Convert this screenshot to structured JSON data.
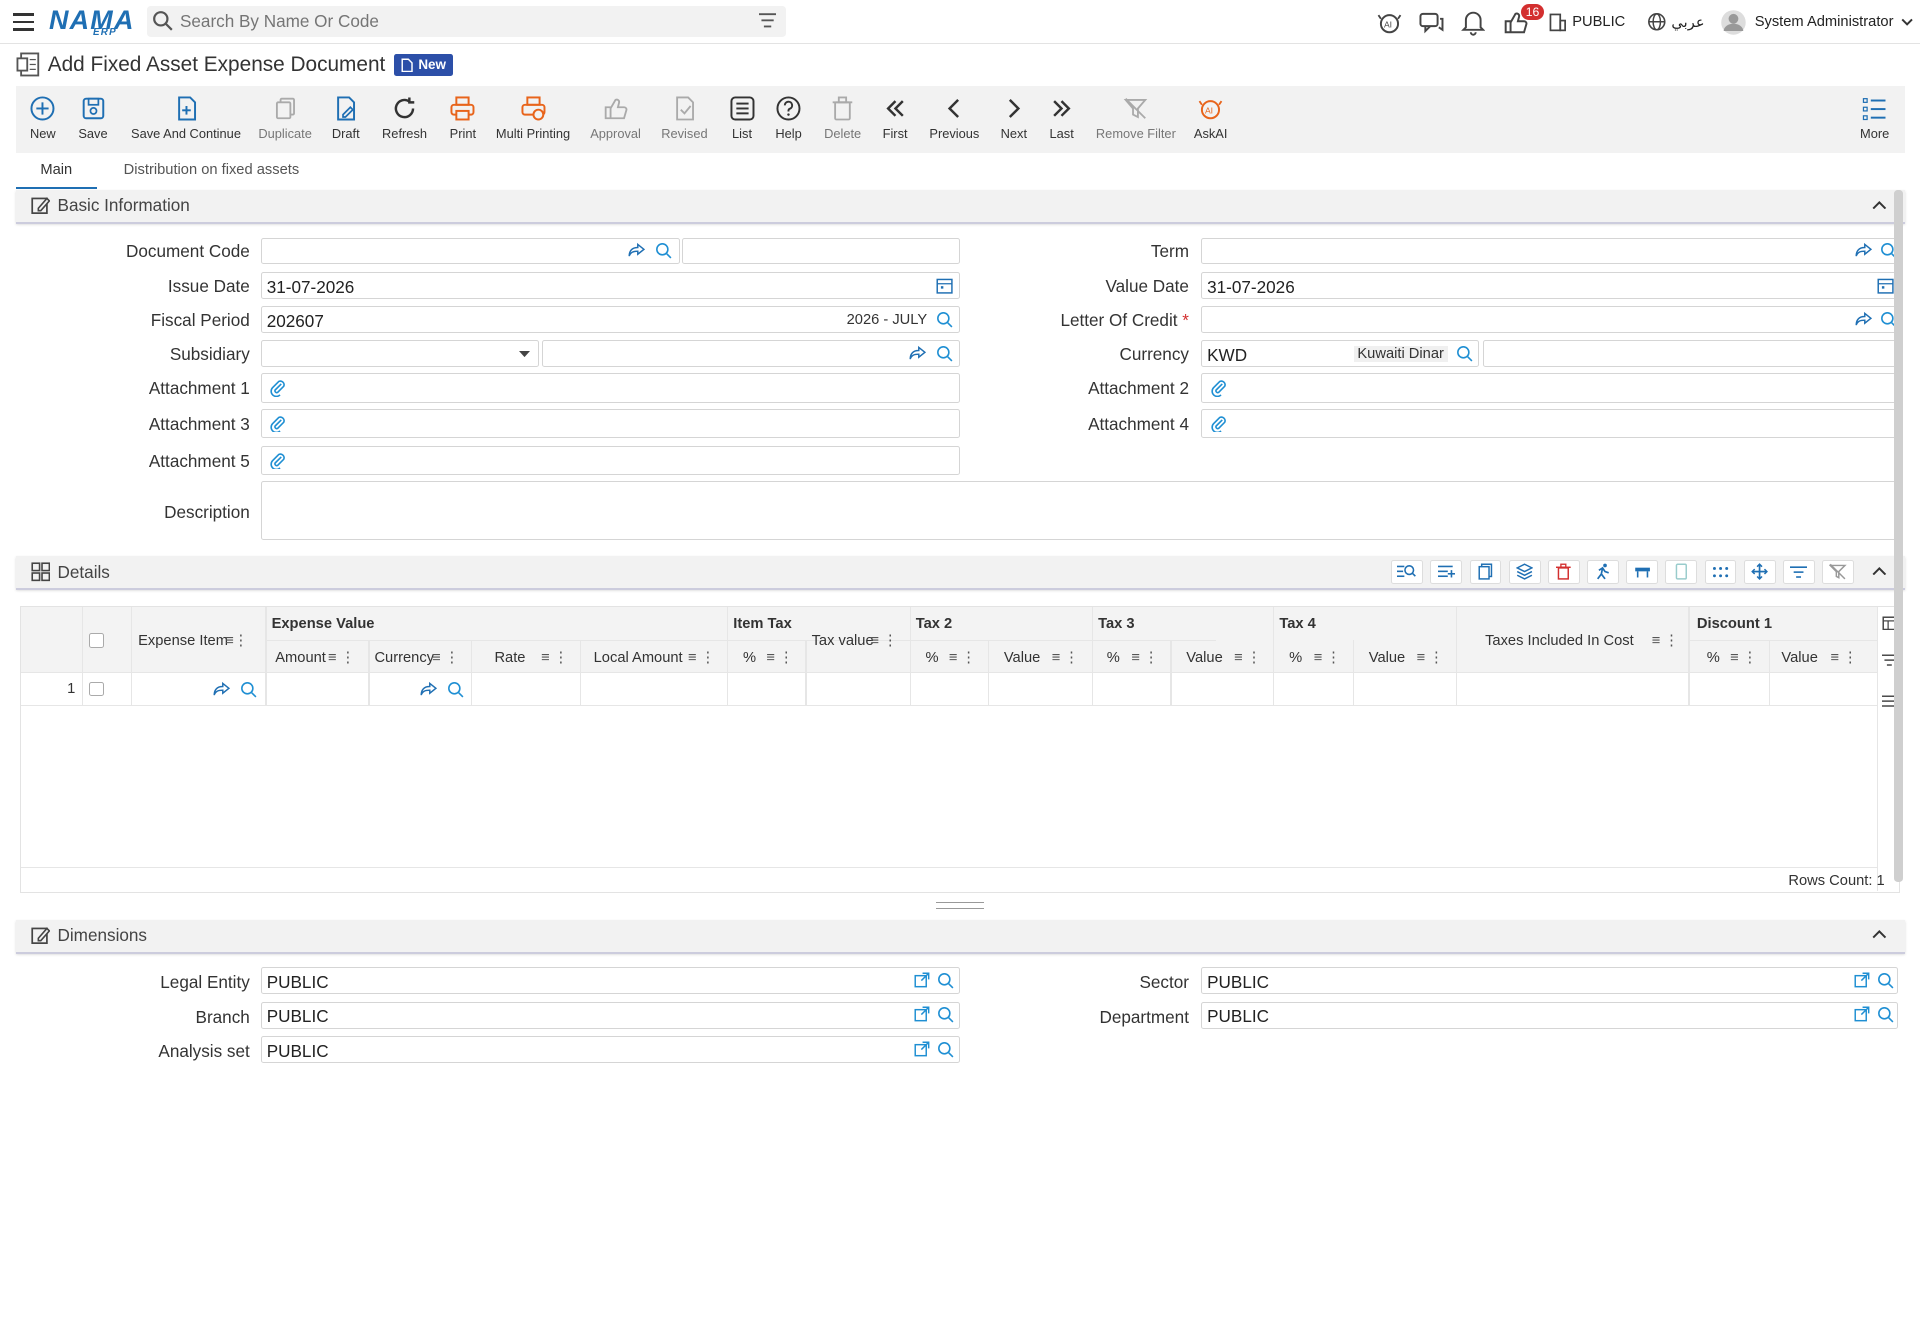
{
  "app": {
    "logo": "NAMA",
    "logo_sub": "ERP"
  },
  "search": {
    "placeholder": "Search By Name Or Code"
  },
  "topbar": {
    "notif_count": "16",
    "company": "PUBLIC",
    "language": "عربي",
    "user": "System Administrator"
  },
  "page": {
    "title": "Add Fixed Asset Expense Document",
    "badge": "New"
  },
  "toolbar": [
    {
      "label": "New"
    },
    {
      "label": "Save"
    },
    {
      "label": "Save And Continue"
    },
    {
      "label": "Duplicate"
    },
    {
      "label": "Draft"
    },
    {
      "label": "Refresh"
    },
    {
      "label": "Print"
    },
    {
      "label": "Multi Printing"
    },
    {
      "label": "Approval"
    },
    {
      "label": "Revised"
    },
    {
      "label": "List"
    },
    {
      "label": "Help"
    },
    {
      "label": "Delete"
    },
    {
      "label": "First"
    },
    {
      "label": "Previous"
    },
    {
      "label": "Next"
    },
    {
      "label": "Last"
    },
    {
      "label": "Remove Filter"
    },
    {
      "label": "AskAI"
    },
    {
      "label": "More"
    }
  ],
  "tabs": [
    "Main",
    "Distribution on fixed assets"
  ],
  "basic": {
    "title": "Basic Information",
    "document_code": {
      "label": "Document Code",
      "value": ""
    },
    "issue_date": {
      "label": "Issue Date",
      "value": "31-07-2026"
    },
    "fiscal_period": {
      "label": "Fiscal Period",
      "value": "202607",
      "desc": "2026 - JULY"
    },
    "subsidiary": {
      "label": "Subsidiary",
      "value": ""
    },
    "attachment1": {
      "label": "Attachment 1"
    },
    "attachment3": {
      "label": "Attachment 3"
    },
    "attachment5": {
      "label": "Attachment 5"
    },
    "description": {
      "label": "Description",
      "value": ""
    },
    "term": {
      "label": "Term",
      "value": ""
    },
    "value_date": {
      "label": "Value Date",
      "value": "31-07-2026"
    },
    "letter_of_credit": {
      "label": "Letter Of Credit",
      "required": "*"
    },
    "currency": {
      "label": "Currency",
      "value": "KWD",
      "desc": "Kuwaiti Dinar"
    },
    "attachment2": {
      "label": "Attachment 2"
    },
    "attachment4": {
      "label": "Attachment 4"
    }
  },
  "details": {
    "title": "Details",
    "headers": {
      "expense_item": "Expense Item",
      "expense_value": "Expense Value",
      "amount": "Amount",
      "currency": "Currency",
      "rate": "Rate",
      "local_amount": "Local Amount",
      "item_tax": "Item Tax",
      "pct": "%",
      "tax_value": "Tax value",
      "tax2": "Tax 2",
      "tax3": "Tax 3",
      "tax4": "Tax 4",
      "value": "Value",
      "taxes_included": "Taxes Included In Cost",
      "discount1": "Discount 1"
    },
    "rows": [
      {
        "num": "1"
      }
    ],
    "rows_count": "Rows Count: 1"
  },
  "dimensions": {
    "title": "Dimensions",
    "legal_entity": {
      "label": "Legal Entity",
      "value": "PUBLIC"
    },
    "branch": {
      "label": "Branch",
      "value": "PUBLIC"
    },
    "analysis_set": {
      "label": "Analysis set",
      "value": "PUBLIC"
    },
    "sector": {
      "label": "Sector",
      "value": "PUBLIC"
    },
    "department": {
      "label": "Department",
      "value": "PUBLIC"
    }
  }
}
